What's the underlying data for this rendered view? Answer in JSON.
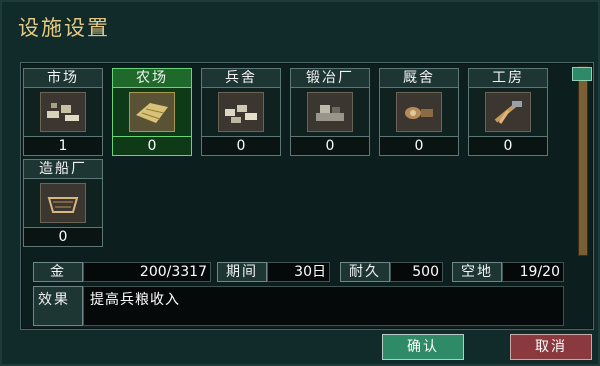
{
  "dialog": {
    "title": "设施设置"
  },
  "buildings": [
    {
      "name": "市场",
      "count": "1",
      "icon": "market-goods-icon",
      "selected": false
    },
    {
      "name": "农场",
      "count": "0",
      "icon": "farm-field-icon",
      "selected": true
    },
    {
      "name": "兵舍",
      "count": "0",
      "icon": "barracks-icon",
      "selected": false
    },
    {
      "name": "锻冶厂",
      "count": "0",
      "icon": "forge-icon",
      "selected": false
    },
    {
      "name": "厩舍",
      "count": "0",
      "icon": "stable-icon",
      "selected": false
    },
    {
      "name": "工房",
      "count": "0",
      "icon": "workshop-icon",
      "selected": false
    },
    {
      "name": "造船厂",
      "count": "0",
      "icon": "shipyard-icon",
      "selected": false
    }
  ],
  "stats": {
    "gold_label": "金",
    "gold_value": "200/3317",
    "period_label": "期间",
    "period_value": "30日",
    "durability_label": "耐久",
    "durability_value": "500",
    "land_label": "空地",
    "land_value": "19/20"
  },
  "effect": {
    "label": "效果",
    "text": "提高兵粮收入"
  },
  "buttons": {
    "confirm": "确认",
    "cancel": "取消"
  },
  "colors": {
    "title": "#e3c983",
    "selected_border": "#6ad47a",
    "confirm_bg": "#2f8a67",
    "cancel_bg": "#8a3a3e"
  }
}
